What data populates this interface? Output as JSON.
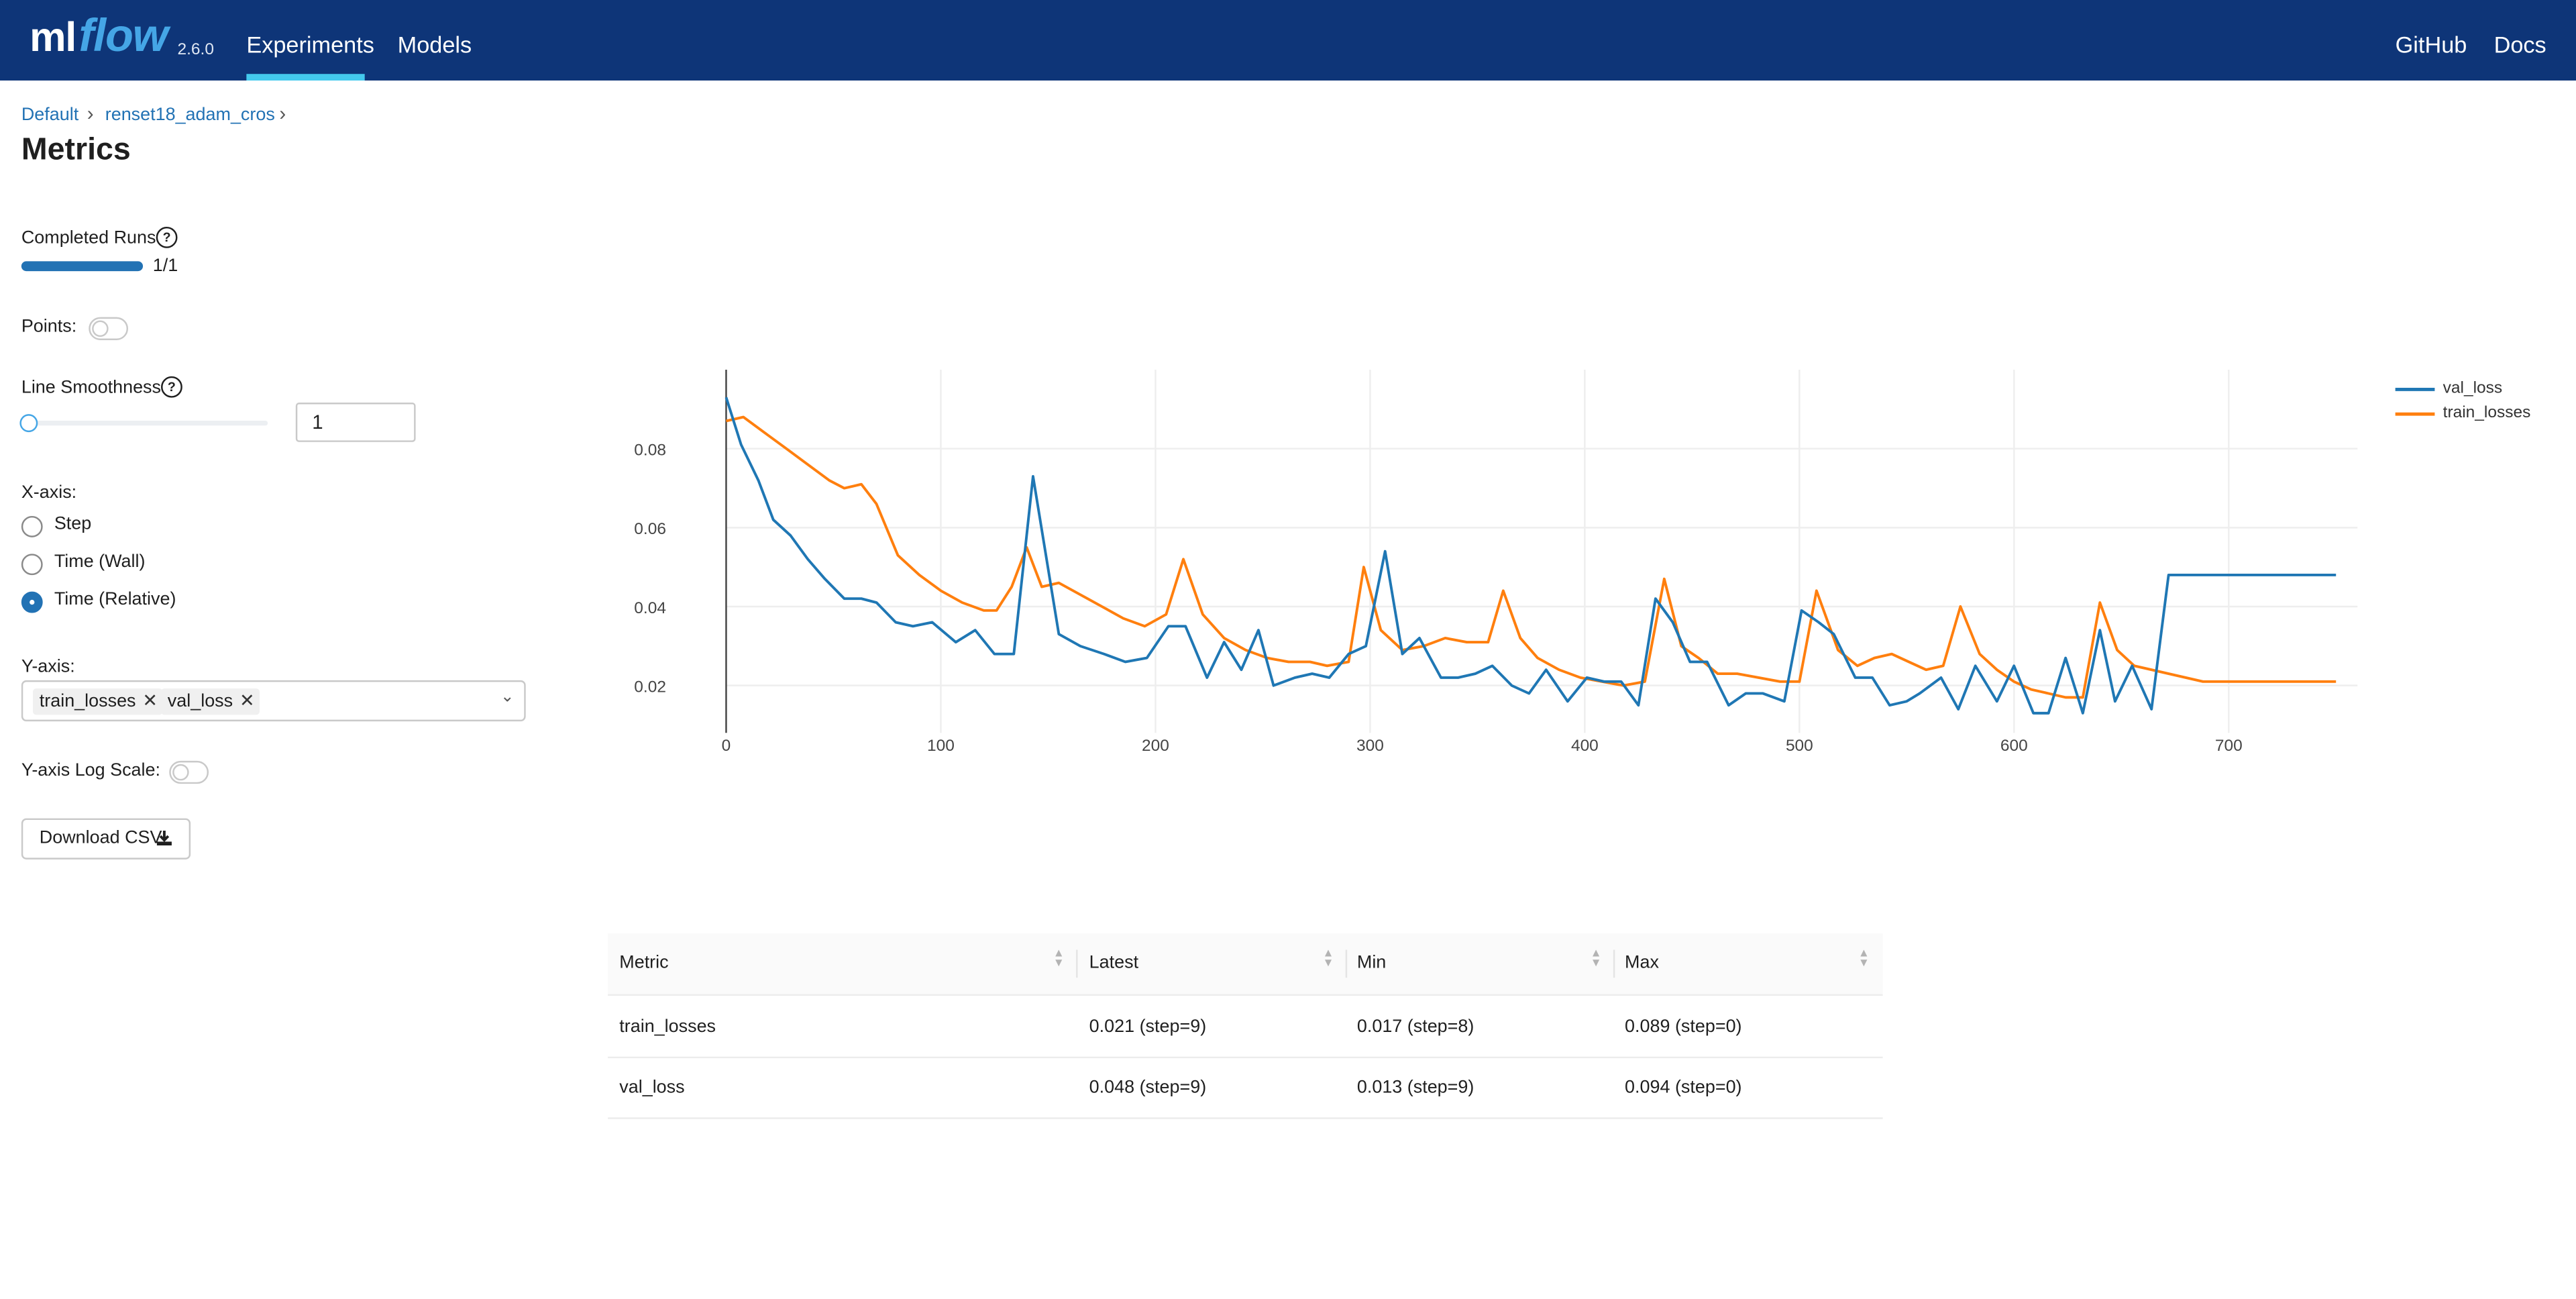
{
  "header": {
    "logo_ml": "ml",
    "logo_flow": "flow",
    "version": "2.6.0",
    "nav": [
      {
        "label": "Experiments",
        "active": true
      },
      {
        "label": "Models",
        "active": false
      }
    ],
    "right_links": [
      "GitHub",
      "Docs"
    ],
    "colors": {
      "bar": "#0e3578",
      "active_underline": "#43c9ed",
      "logo_accent": "#45a6e6"
    }
  },
  "breadcrumb": [
    "Default",
    "renset18_adam_cros"
  ],
  "page_title": "Metrics",
  "controls": {
    "completed_runs": {
      "label": "Completed Runs",
      "value_text": "1/1",
      "progress": 1.0
    },
    "points": {
      "label": "Points:",
      "enabled": false
    },
    "line_smoothness": {
      "label": "Line Smoothness",
      "value": "1",
      "slider_fraction": 0.0
    },
    "x_axis": {
      "label": "X-axis:",
      "options": [
        "Step",
        "Time (Wall)",
        "Time (Relative)"
      ],
      "selected": "Time (Relative)"
    },
    "y_axis": {
      "label": "Y-axis:",
      "selected": [
        "train_losses",
        "val_loss"
      ]
    },
    "y_log_scale": {
      "label": "Y-axis Log Scale:",
      "enabled": false
    },
    "download_label": "Download CSV",
    "icons": {
      "help": "question-circle-icon",
      "download": "download-icon",
      "remove": "close-icon",
      "dropdown": "chevron-down-icon"
    }
  },
  "chart_data": {
    "type": "line",
    "xlim": [
      0,
      760
    ],
    "ylim": [
      0.008,
      0.1
    ],
    "xticks": [
      0,
      100,
      200,
      300,
      400,
      500,
      600,
      700
    ],
    "yticks": [
      0.02,
      0.04,
      0.06,
      0.08
    ],
    "grid": true,
    "legend_position": "top-right",
    "series": [
      {
        "name": "val_loss",
        "color": "#1f77b4",
        "x": [
          0,
          7,
          15,
          22,
          30,
          38,
          46,
          55,
          63,
          70,
          79,
          87,
          96,
          107,
          116,
          125,
          134,
          143,
          155,
          165,
          176,
          186,
          196,
          206,
          214,
          224,
          232,
          240,
          248,
          255,
          265,
          273,
          281,
          290,
          298,
          307,
          315,
          323,
          333,
          341,
          349,
          357,
          366,
          374,
          382,
          392,
          401,
          409,
          417,
          425,
          433,
          441,
          449,
          457,
          467,
          475,
          483,
          493,
          501,
          509,
          516,
          526,
          534,
          542,
          550,
          556,
          566,
          574,
          582,
          592,
          600,
          609,
          616,
          624,
          632,
          640,
          647,
          655,
          664,
          672,
          680,
          689,
          697,
          706,
          714,
          722,
          729,
          737,
          745,
          750
        ],
        "y": [
          0.093,
          0.081,
          0.072,
          0.062,
          0.058,
          0.052,
          0.047,
          0.042,
          0.042,
          0.041,
          0.036,
          0.035,
          0.036,
          0.031,
          0.034,
          0.028,
          0.028,
          0.073,
          0.033,
          0.03,
          0.028,
          0.026,
          0.027,
          0.035,
          0.035,
          0.022,
          0.031,
          0.024,
          0.034,
          0.02,
          0.022,
          0.023,
          0.022,
          0.028,
          0.03,
          0.054,
          0.028,
          0.032,
          0.022,
          0.022,
          0.023,
          0.025,
          0.02,
          0.018,
          0.024,
          0.016,
          0.022,
          0.021,
          0.021,
          0.015,
          0.042,
          0.036,
          0.026,
          0.026,
          0.015,
          0.018,
          0.018,
          0.016,
          0.039,
          0.036,
          0.033,
          0.022,
          0.022,
          0.015,
          0.016,
          0.018,
          0.022,
          0.014,
          0.025,
          0.016,
          0.025,
          0.013,
          0.013,
          0.027,
          0.013,
          0.034,
          0.016,
          0.025,
          0.014,
          0.048,
          0.048,
          0.048,
          0.048,
          0.048,
          0.048,
          0.048,
          0.048,
          0.048,
          0.048,
          0.048
        ]
      },
      {
        "name": "train_losses",
        "color": "#ff7f0e",
        "x": [
          0,
          8,
          18,
          28,
          38,
          48,
          55,
          63,
          70,
          80,
          90,
          100,
          110,
          120,
          126,
          133,
          140,
          147,
          155,
          165,
          175,
          185,
          195,
          205,
          213,
          222,
          232,
          242,
          252,
          262,
          272,
          280,
          290,
          297,
          305,
          315,
          325,
          335,
          345,
          355,
          362,
          370,
          378,
          388,
          398,
          408,
          418,
          428,
          437,
          445,
          453,
          462,
          471,
          481,
          491,
          500,
          508,
          518,
          527,
          535,
          543,
          551,
          559,
          567,
          575,
          584,
          592,
          600,
          608,
          616,
          624,
          632,
          640,
          648,
          656,
          664,
          672,
          680,
          688,
          696,
          704,
          712,
          720,
          728,
          736,
          744,
          750
        ],
        "y": [
          0.087,
          0.088,
          0.084,
          0.08,
          0.076,
          0.072,
          0.07,
          0.071,
          0.066,
          0.053,
          0.048,
          0.044,
          0.041,
          0.039,
          0.039,
          0.045,
          0.055,
          0.045,
          0.046,
          0.043,
          0.04,
          0.037,
          0.035,
          0.038,
          0.052,
          0.038,
          0.032,
          0.029,
          0.027,
          0.026,
          0.026,
          0.025,
          0.026,
          0.05,
          0.034,
          0.029,
          0.03,
          0.032,
          0.031,
          0.031,
          0.044,
          0.032,
          0.027,
          0.024,
          0.022,
          0.021,
          0.02,
          0.021,
          0.047,
          0.03,
          0.027,
          0.023,
          0.023,
          0.022,
          0.021,
          0.021,
          0.044,
          0.029,
          0.025,
          0.027,
          0.028,
          0.026,
          0.024,
          0.025,
          0.04,
          0.028,
          0.024,
          0.021,
          0.019,
          0.018,
          0.017,
          0.017,
          0.041,
          0.029,
          0.025,
          0.024,
          0.023,
          0.022,
          0.021,
          0.021,
          0.021,
          0.021,
          0.021,
          0.021,
          0.021,
          0.021,
          0.021
        ]
      }
    ]
  },
  "table": {
    "columns": [
      "Metric",
      "Latest",
      "Min",
      "Max"
    ],
    "rows": [
      [
        "train_losses",
        "0.021 (step=9)",
        "0.017 (step=8)",
        "0.089 (step=0)"
      ],
      [
        "val_loss",
        "0.048 (step=9)",
        "0.013 (step=9)",
        "0.094 (step=0)"
      ]
    ]
  }
}
